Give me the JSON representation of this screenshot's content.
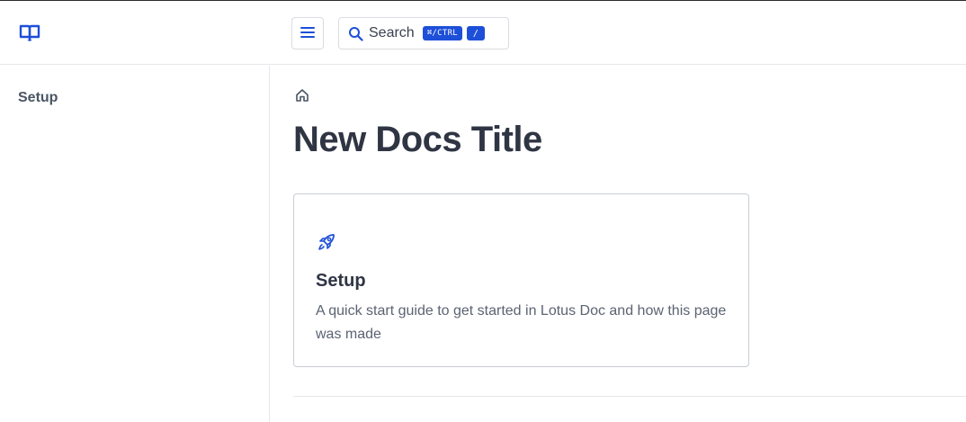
{
  "header": {
    "logo_icon": "book-open-icon",
    "menu_icon": "hamburger-menu-icon",
    "search": {
      "icon": "search-icon",
      "label": "Search",
      "shortcut_modifier": "⌘/CTRL",
      "shortcut_key": "/"
    }
  },
  "sidebar": {
    "items": [
      {
        "label": "Setup"
      }
    ]
  },
  "main": {
    "breadcrumb_icon": "home-icon",
    "title": "New Docs Title",
    "cards": [
      {
        "icon": "rocket-icon",
        "title": "Setup",
        "description": "A quick start guide to get started in Lotus Doc and how this page was made"
      }
    ]
  },
  "colors": {
    "accent": "#1d4fd8",
    "text": "#2f3543",
    "muted_text": "#5b6372",
    "border": "#e5e7eb"
  }
}
